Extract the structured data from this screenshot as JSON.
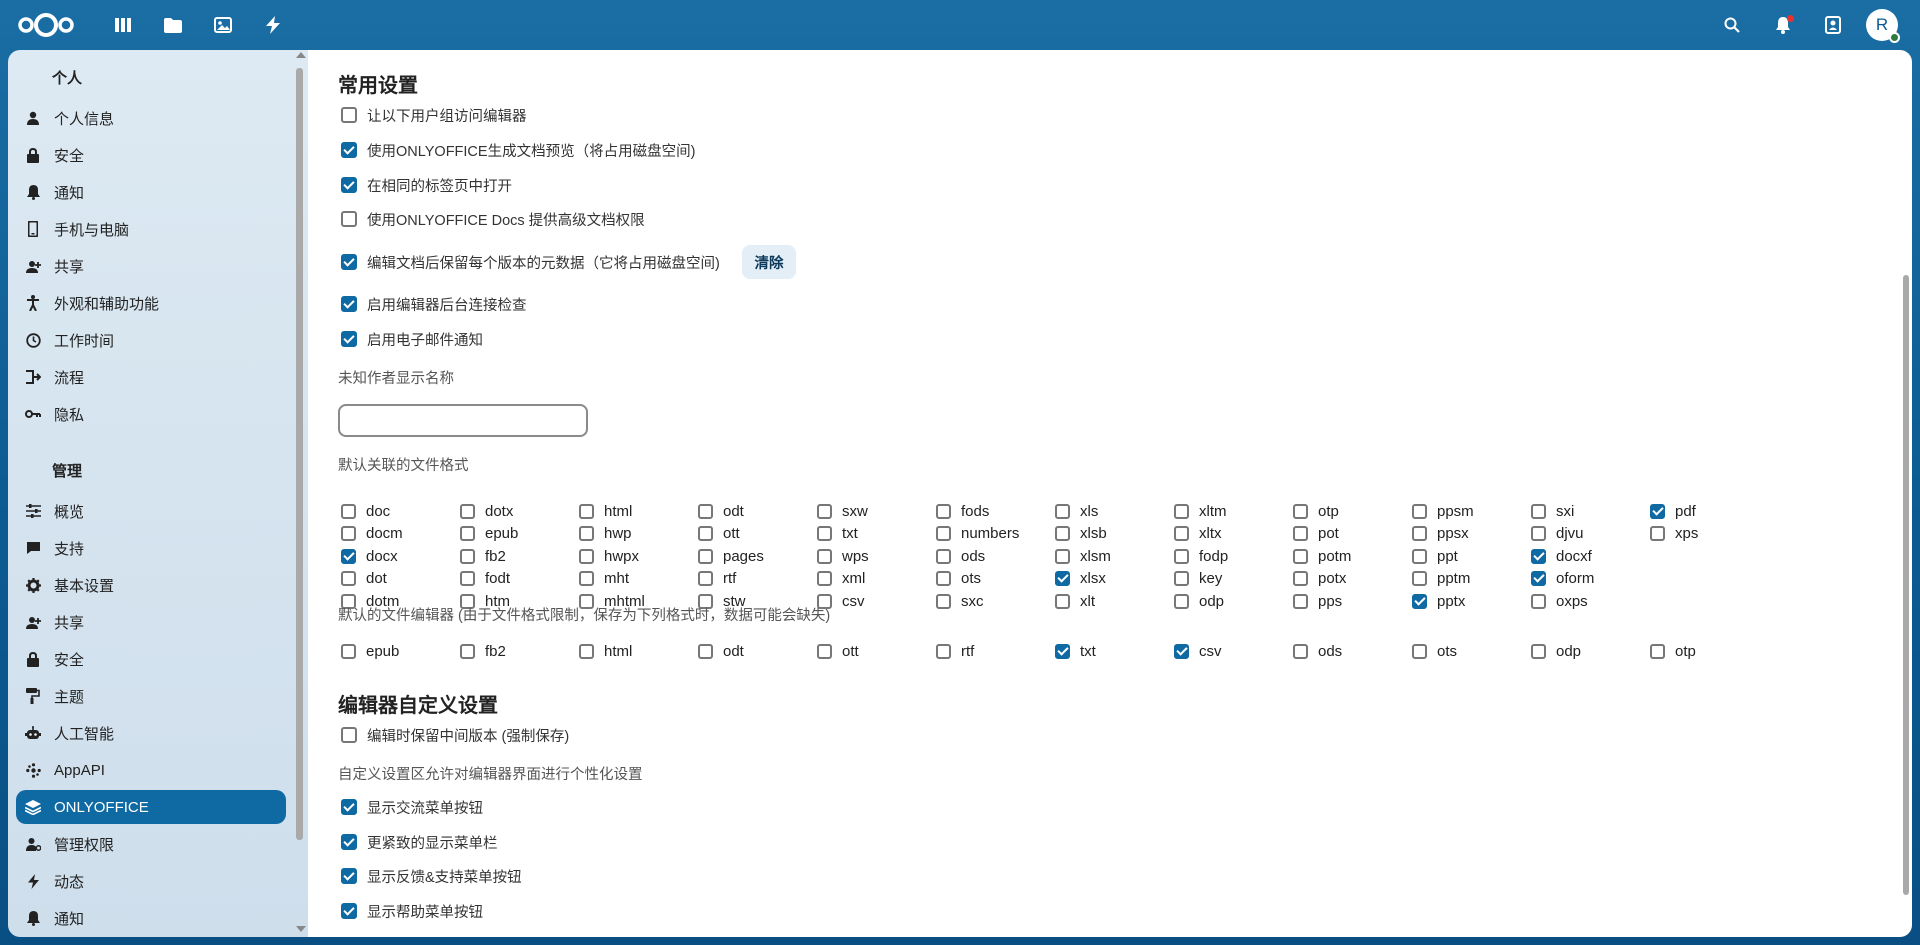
{
  "header": {
    "apps": [
      {
        "icon": "dashboard-icon"
      },
      {
        "icon": "files-icon"
      },
      {
        "icon": "photos-icon"
      },
      {
        "icon": "activity-icon"
      }
    ],
    "right": [
      {
        "icon": "search-icon"
      },
      {
        "icon": "notifications-icon"
      },
      {
        "icon": "contacts-icon"
      }
    ],
    "avatar_letter": "R"
  },
  "sidebar": {
    "personal_heading": "个人",
    "personal_items": [
      {
        "label": "个人信息",
        "icon": "person-icon"
      },
      {
        "label": "安全",
        "icon": "lock-icon"
      },
      {
        "label": "通知",
        "icon": "bell-icon"
      },
      {
        "label": "手机与电脑",
        "icon": "phone-icon"
      },
      {
        "label": "共享",
        "icon": "share-icon"
      },
      {
        "label": "外观和辅助功能",
        "icon": "accessibility-icon"
      },
      {
        "label": "工作时间",
        "icon": "clock-icon"
      },
      {
        "label": "流程",
        "icon": "flow-icon"
      },
      {
        "label": "隐私",
        "icon": "key-icon"
      }
    ],
    "admin_heading": "管理",
    "admin_items": [
      {
        "label": "概览",
        "icon": "sliders-icon"
      },
      {
        "label": "支持",
        "icon": "chat-icon"
      },
      {
        "label": "基本设置",
        "icon": "gear-icon"
      },
      {
        "label": "共享",
        "icon": "share-icon"
      },
      {
        "label": "安全",
        "icon": "lock-icon"
      },
      {
        "label": "主题",
        "icon": "paint-roller-icon"
      },
      {
        "label": "人工智能",
        "icon": "robot-icon"
      },
      {
        "label": "AppAPI",
        "icon": "api-icon"
      },
      {
        "label": "ONLYOFFICE",
        "icon": "layers-icon",
        "active": true
      },
      {
        "label": "管理权限",
        "icon": "admin-person-icon"
      },
      {
        "label": "动态",
        "icon": "lightning-icon"
      },
      {
        "label": "通知",
        "icon": "bell-icon"
      }
    ]
  },
  "main": {
    "common_title": "常用设置",
    "common_options": [
      {
        "label": "让以下用户组访问编辑器",
        "checked": false
      },
      {
        "label": "使用ONLYOFFICE生成文档预览（将占用磁盘空间)",
        "checked": true
      },
      {
        "label": "在相同的标签页中打开",
        "checked": true
      },
      {
        "label": "使用ONLYOFFICE Docs 提供高级文档权限",
        "checked": false
      },
      {
        "label": "编辑文档后保留每个版本的元数据（它将占用磁盘空间)",
        "checked": true
      },
      {
        "label": "启用编辑器后台连接检查",
        "checked": true
      },
      {
        "label": "启用电子邮件通知",
        "checked": true
      }
    ],
    "clear_button": "清除",
    "unknown_author_label": "未知作者显示名称",
    "unknown_author_value": "",
    "default_formats_label": "默认关联的文件格式",
    "default_formats": [
      [
        "doc",
        false
      ],
      [
        "dotx",
        false
      ],
      [
        "html",
        false
      ],
      [
        "odt",
        false
      ],
      [
        "sxw",
        false
      ],
      [
        "fods",
        false
      ],
      [
        "xls",
        false
      ],
      [
        "xltm",
        false
      ],
      [
        "otp",
        false
      ],
      [
        "ppsm",
        false
      ],
      [
        "sxi",
        false
      ],
      [
        "pdf",
        true
      ],
      [
        "docm",
        false
      ],
      [
        "epub",
        false
      ],
      [
        "hwp",
        false
      ],
      [
        "ott",
        false
      ],
      [
        "txt",
        false
      ],
      [
        "numbers",
        false
      ],
      [
        "xlsb",
        false
      ],
      [
        "xltx",
        false
      ],
      [
        "pot",
        false
      ],
      [
        "ppsx",
        false
      ],
      [
        "djvu",
        false
      ],
      [
        "xps",
        false
      ],
      [
        "docx",
        true
      ],
      [
        "fb2",
        false
      ],
      [
        "hwpx",
        false
      ],
      [
        "pages",
        false
      ],
      [
        "wps",
        false
      ],
      [
        "ods",
        false
      ],
      [
        "xlsm",
        false
      ],
      [
        "fodp",
        false
      ],
      [
        "potm",
        false
      ],
      [
        "ppt",
        false
      ],
      [
        "docxf",
        true
      ],
      null,
      [
        "dot",
        false
      ],
      [
        "fodt",
        false
      ],
      [
        "mht",
        false
      ],
      [
        "rtf",
        false
      ],
      [
        "xml",
        false
      ],
      [
        "ots",
        false
      ],
      [
        "xlsx",
        true
      ],
      [
        "key",
        false
      ],
      [
        "potx",
        false
      ],
      [
        "pptm",
        false
      ],
      [
        "oform",
        true
      ],
      null,
      [
        "dotm",
        false
      ],
      [
        "htm",
        false
      ],
      [
        "mhtml",
        false
      ],
      [
        "stw",
        false
      ],
      [
        "csv",
        false
      ],
      [
        "sxc",
        false
      ],
      [
        "xlt",
        false
      ],
      [
        "odp",
        false
      ],
      [
        "pps",
        false
      ],
      [
        "pptx",
        true
      ],
      [
        "oxps",
        false
      ],
      null
    ],
    "editable_label": "默认的文件编辑器 (由于文件格式限制，保存为下列格式时，数据可能会缺失)",
    "editable_formats": [
      [
        "epub",
        false
      ],
      [
        "fb2",
        false
      ],
      [
        "html",
        false
      ],
      [
        "odt",
        false
      ],
      [
        "ott",
        false
      ],
      [
        "rtf",
        false
      ],
      [
        "txt",
        true
      ],
      [
        "csv",
        true
      ],
      [
        "ods",
        false
      ],
      [
        "ots",
        false
      ],
      [
        "odp",
        false
      ],
      [
        "otp",
        false
      ]
    ],
    "editor_title": "编辑器自定义设置",
    "force_save": {
      "label": "编辑时保留中间版本 (强制保存)",
      "checked": false
    },
    "customization_label": "自定义设置区允许对编辑器界面进行个性化设置",
    "customization_options": [
      {
        "label": "显示交流菜单按钮",
        "checked": true
      },
      {
        "label": "更紧致的显示菜单栏",
        "checked": true
      },
      {
        "label": "显示反馈&支持菜单按钮",
        "checked": true
      },
      {
        "label": "显示帮助菜单按钮",
        "checked": true
      }
    ]
  }
}
